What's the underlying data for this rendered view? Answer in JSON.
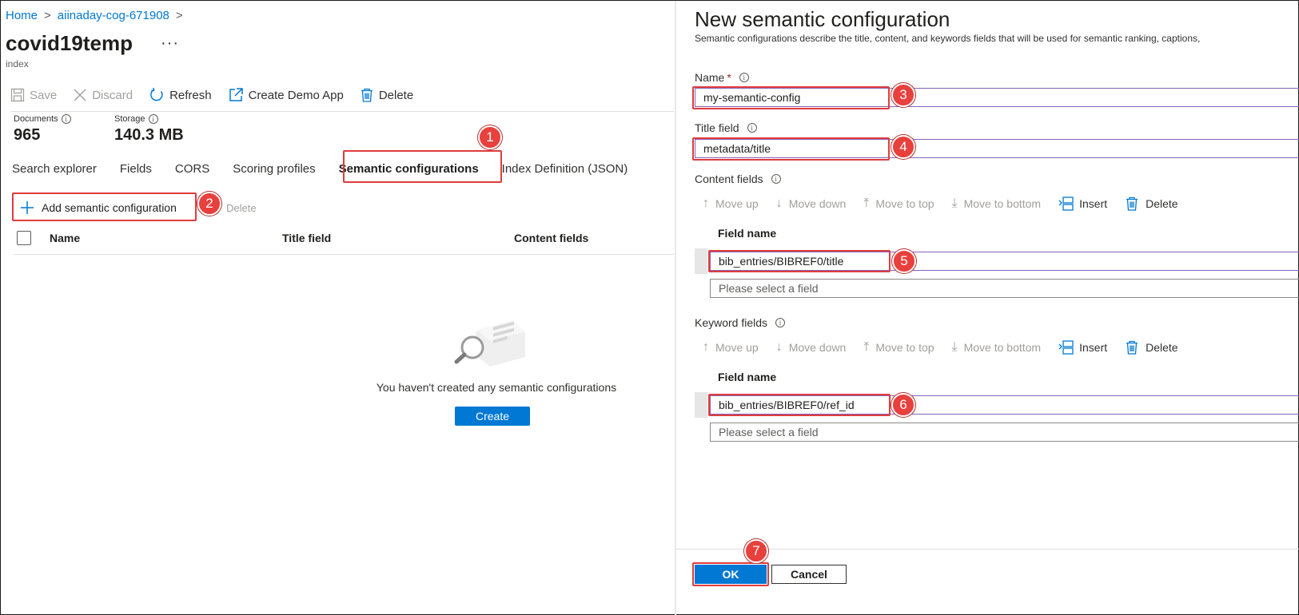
{
  "breadcrumb": {
    "home": "Home",
    "service": "aiinaday-cog-671908"
  },
  "page": {
    "title": "covid19temp",
    "more": "···",
    "subtitle": "index"
  },
  "toolbar": {
    "save": "Save",
    "discard": "Discard",
    "refresh": "Refresh",
    "create_demo_app": "Create Demo App",
    "delete": "Delete"
  },
  "stats": {
    "documents_label": "Documents",
    "documents_value": "965",
    "storage_label": "Storage",
    "storage_value": "140.3 MB"
  },
  "tabs": [
    "Search explorer",
    "Fields",
    "CORS",
    "Scoring profiles",
    "Semantic configurations",
    "Index Definition (JSON)"
  ],
  "semantic_list": {
    "add_label": "Add semantic configuration",
    "delete_label": "Delete",
    "columns": [
      "Name",
      "Title field",
      "Content fields"
    ],
    "empty_message": "You haven't created any semantic configurations",
    "create_label": "Create"
  },
  "panel": {
    "title": "New semantic configuration",
    "description": "Semantic configurations describe the title, content, and keywords fields that will be used for semantic ranking, captions,",
    "name_label": "Name",
    "name_required": "*",
    "name_value": "my-semantic-config",
    "title_field_label": "Title field",
    "title_field_value": "metadata/title",
    "content_fields_label": "Content fields",
    "keyword_fields_label": "Keyword fields",
    "list_toolbar": {
      "move_up": "Move up",
      "move_down": "Move down",
      "move_to_top": "Move to top",
      "move_to_bottom": "Move to bottom",
      "insert": "Insert",
      "delete": "Delete"
    },
    "field_name_header": "Field name",
    "content_field_value": "bib_entries/BIBREF0/title",
    "keyword_field_value": "bib_entries/BIBREF0/ref_id",
    "select_placeholder": "Please select a field",
    "ok_label": "OK",
    "cancel_label": "Cancel"
  },
  "annotations": [
    "1",
    "2",
    "3",
    "4",
    "5",
    "6",
    "7"
  ],
  "colors": {
    "accent": "#0078d4",
    "annotation_red": "#e8403d",
    "input_purple": "#8764b8"
  }
}
